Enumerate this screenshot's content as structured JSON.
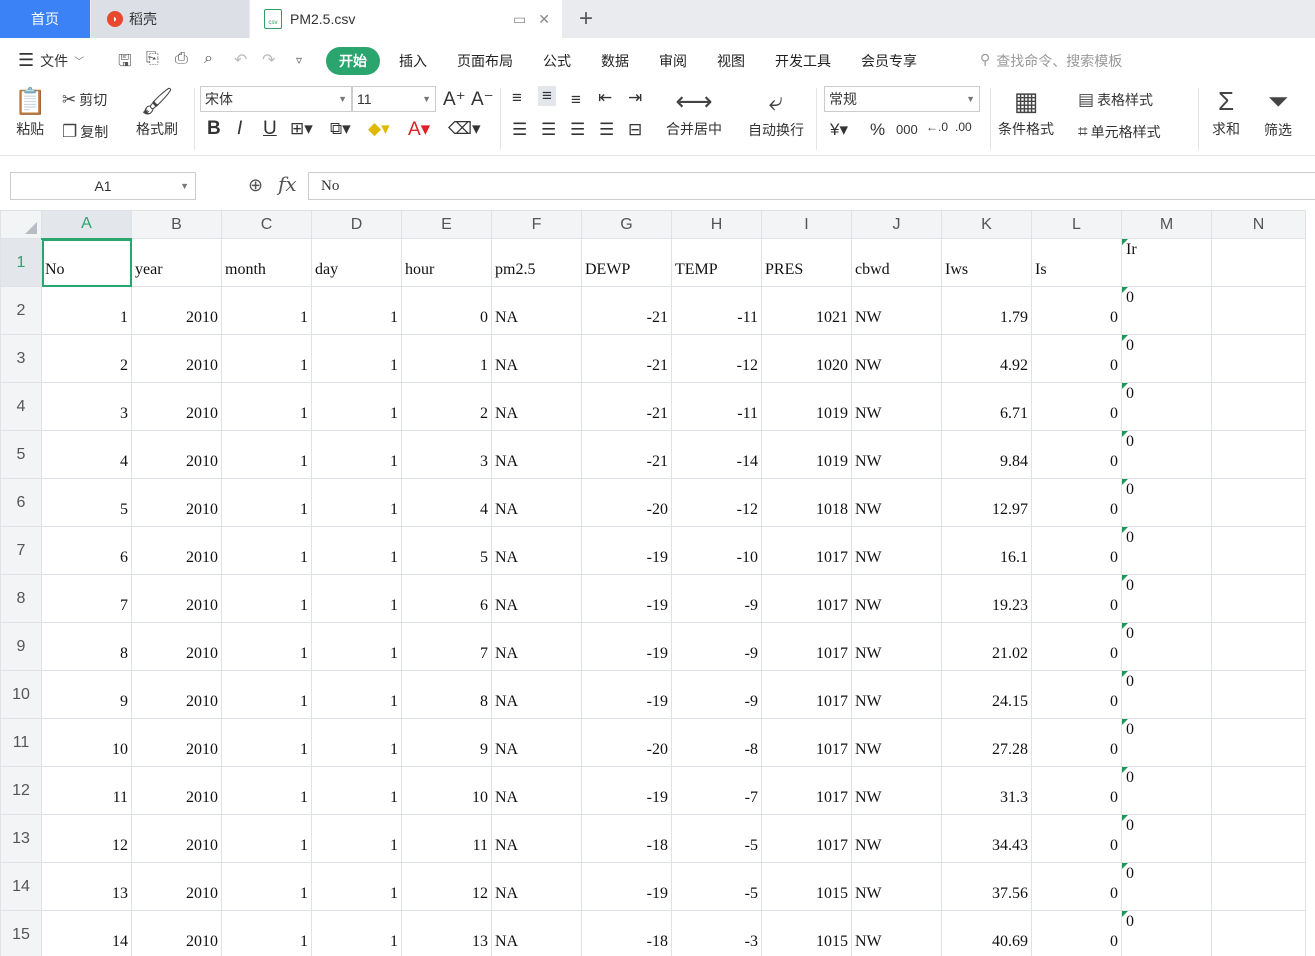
{
  "tabs": {
    "home": "首页",
    "daoke": "稻壳",
    "file": "PM2.5.csv",
    "csv_badge": "csv"
  },
  "menu": {
    "file_label": "文件",
    "tabs": [
      "开始",
      "插入",
      "页面布局",
      "公式",
      "数据",
      "审阅",
      "视图",
      "开发工具",
      "会员专享"
    ],
    "search_placeholder": "查找命令、搜索模板"
  },
  "ribbon": {
    "paste": "粘贴",
    "cut": "剪切",
    "copy": "复制",
    "format_painter": "格式刷",
    "font_name": "宋体",
    "font_size": "11",
    "merge_center": "合并居中",
    "wrap_text": "自动换行",
    "number_format": "常规",
    "conditional_format": "条件格式",
    "table_style": "表格样式",
    "cell_style": "单元格样式",
    "sum": "求和",
    "filter": "筛选"
  },
  "formula_bar": {
    "cell_ref": "A1",
    "fx": "fx",
    "value": "No"
  },
  "grid": {
    "columns": [
      "A",
      "B",
      "C",
      "D",
      "E",
      "F",
      "G",
      "H",
      "I",
      "J",
      "K",
      "L",
      "M",
      "N"
    ],
    "header_row": [
      "No",
      "year",
      "month",
      "day",
      "hour",
      "pm2.5",
      "DEWP",
      "TEMP",
      "PRES",
      "cbwd",
      "Iws",
      "Is",
      "Ir",
      ""
    ],
    "rows": [
      [
        "1",
        "2010",
        "1",
        "1",
        "0",
        "NA",
        "-21",
        "-11",
        "1021",
        "NW",
        "1.79",
        "0",
        "0"
      ],
      [
        "2",
        "2010",
        "1",
        "1",
        "1",
        "NA",
        "-21",
        "-12",
        "1020",
        "NW",
        "4.92",
        "0",
        "0"
      ],
      [
        "3",
        "2010",
        "1",
        "1",
        "2",
        "NA",
        "-21",
        "-11",
        "1019",
        "NW",
        "6.71",
        "0",
        "0"
      ],
      [
        "4",
        "2010",
        "1",
        "1",
        "3",
        "NA",
        "-21",
        "-14",
        "1019",
        "NW",
        "9.84",
        "0",
        "0"
      ],
      [
        "5",
        "2010",
        "1",
        "1",
        "4",
        "NA",
        "-20",
        "-12",
        "1018",
        "NW",
        "12.97",
        "0",
        "0"
      ],
      [
        "6",
        "2010",
        "1",
        "1",
        "5",
        "NA",
        "-19",
        "-10",
        "1017",
        "NW",
        "16.1",
        "0",
        "0"
      ],
      [
        "7",
        "2010",
        "1",
        "1",
        "6",
        "NA",
        "-19",
        "-9",
        "1017",
        "NW",
        "19.23",
        "0",
        "0"
      ],
      [
        "8",
        "2010",
        "1",
        "1",
        "7",
        "NA",
        "-19",
        "-9",
        "1017",
        "NW",
        "21.02",
        "0",
        "0"
      ],
      [
        "9",
        "2010",
        "1",
        "1",
        "8",
        "NA",
        "-19",
        "-9",
        "1017",
        "NW",
        "24.15",
        "0",
        "0"
      ],
      [
        "10",
        "2010",
        "1",
        "1",
        "9",
        "NA",
        "-20",
        "-8",
        "1017",
        "NW",
        "27.28",
        "0",
        "0"
      ],
      [
        "11",
        "2010",
        "1",
        "1",
        "10",
        "NA",
        "-19",
        "-7",
        "1017",
        "NW",
        "31.3",
        "0",
        "0"
      ],
      [
        "12",
        "2010",
        "1",
        "1",
        "11",
        "NA",
        "-18",
        "-5",
        "1017",
        "NW",
        "34.43",
        "0",
        "0"
      ],
      [
        "13",
        "2010",
        "1",
        "1",
        "12",
        "NA",
        "-19",
        "-5",
        "1015",
        "NW",
        "37.56",
        "0",
        "0"
      ],
      [
        "14",
        "2010",
        "1",
        "1",
        "13",
        "NA",
        "-18",
        "-3",
        "1015",
        "NW",
        "40.69",
        "0",
        "0"
      ]
    ]
  },
  "colors": {
    "accent": "#2aa56e",
    "home_tab": "#3b82f6"
  }
}
